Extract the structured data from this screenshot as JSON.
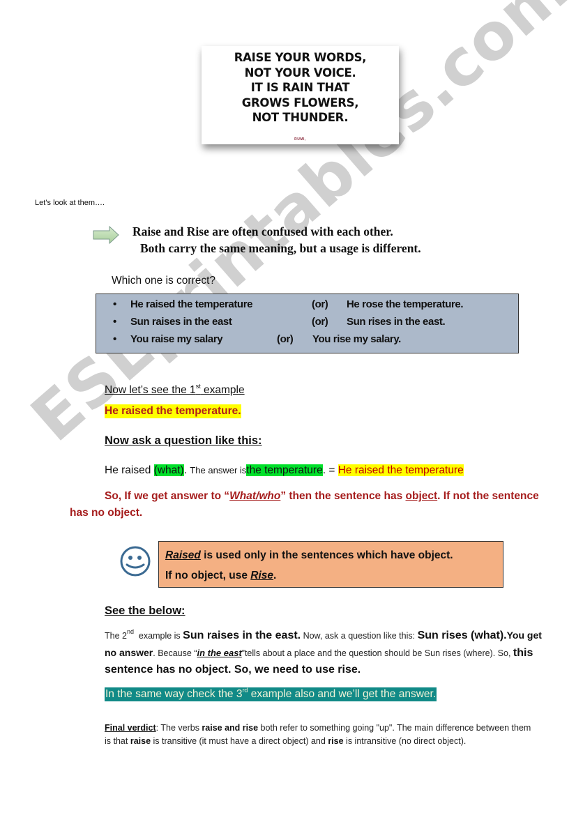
{
  "quote_card": {
    "lines": [
      "RAISE YOUR WORDS,",
      "NOT YOUR VOICE.",
      "IT IS RAIN THAT",
      "GROWS FLOWERS,",
      "NOT THUNDER."
    ],
    "author": "RUMI,"
  },
  "intro": "Let’s look at them….",
  "icons": {
    "arrow": "right-arrow-icon",
    "smiley": "smiley-face-icon"
  },
  "headline": {
    "line1": "Raise and Rise are often confused with each other.",
    "line2": "Both carry the same meaning, but a usage is different."
  },
  "question": "Which one is correct?",
  "options": [
    {
      "bullet": "•",
      "a": "He raised the temperature",
      "or": "(or)",
      "b": "He rose the temperature."
    },
    {
      "bullet": "•",
      "a": "Sun raises in the east",
      "or": "(or)",
      "b": "Sun rises in the east."
    },
    {
      "bullet": "•",
      "a": "You raise my salary",
      "or": "(or)",
      "b": "You rise my salary."
    }
  ],
  "section1": {
    "title_pre": "Now let’s see the 1",
    "title_sup": "st",
    "title_post": " example",
    "example": "He raised the temperature."
  },
  "ask": {
    "title": "Now ask a question like this:",
    "p1": "He raised ",
    "what": "(what)",
    "p2": ". ",
    "answer_is": "The answer is",
    "answer": "the temperature",
    "p3": ". = ",
    "result": "He raised the temperature"
  },
  "so_line": {
    "p1": "So, If we get answer to “",
    "what_who": "What/who",
    "p2": "” then the sentence has ",
    "object": "object",
    "p3": ". If not the sentence has no object."
  },
  "rule_box": {
    "raised": "Raised",
    "line1_rest": " is used only in the sentences which have object.",
    "line2_pre": "If no object, use ",
    "rise": "Rise",
    "line2_post": "."
  },
  "section2": {
    "title": "See the below:",
    "s1": "The 2",
    "s1_sup": "nd",
    "s2": "  example is ",
    "s3": "Sun raises in the east.",
    "s4": " Now, ask a question like this: ",
    "s5": "Sun rises (what).",
    "s6": "You get no answer",
    "s7": ". Because “",
    "s8": "in the east",
    "s9": "”tells about a place and the question should be Sun rises (where). So, ",
    "s10": "this sentence has no object. So, we need to use rise."
  },
  "teal_line": {
    "pre": "In the same way check the 3",
    "sup": "rd",
    "post": " example also and we’ll get the answer."
  },
  "verdict": {
    "label": "Final verdict",
    "t1": ":  The verbs ",
    "b1": "raise and rise",
    "t2": " both refer to something going \"up\". The main difference between them is that ",
    "b2": "raise",
    "t3": " is transitive (it must have a direct object) and ",
    "b3": "rise",
    "t4": " is intransitive (no direct object)."
  },
  "watermark": "ESLprintables.com",
  "colors": {
    "options_box": "#acb9ca",
    "rule_box": "#f4b083",
    "highlight_yellow": "#ffff00",
    "highlight_green": "#00e02a",
    "teal": "#118a87",
    "dark_red": "#a51c1c"
  }
}
